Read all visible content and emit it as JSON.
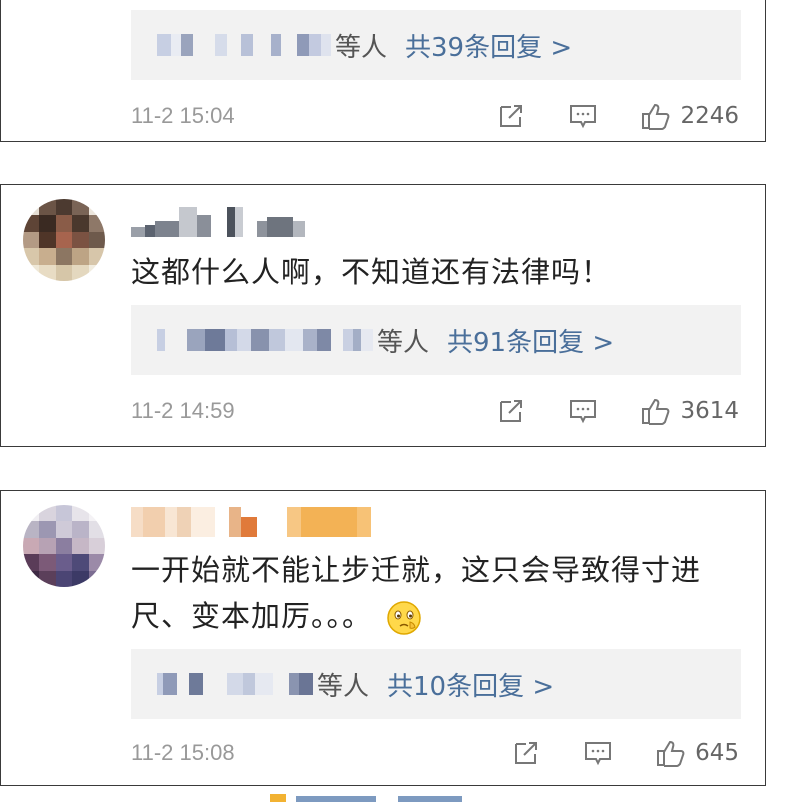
{
  "comments": [
    {
      "reply_suffix": "等人",
      "reply_link": "共39条回复 >",
      "time": "11-2 15:04",
      "likes": "2246"
    },
    {
      "text": "这都什么人啊，不知道还有法律吗！",
      "reply_suffix": "等人",
      "reply_link": "共91条回复 >",
      "time": "11-2 14:59",
      "likes": "3614"
    },
    {
      "text_line1": "一开始就不能让步迁就，这只会导致得寸进",
      "text_line2": "尺、变本加厉。。。",
      "emoji": "thinking-face-emoji",
      "reply_suffix": "等人",
      "reply_link": "共10条回复 >",
      "time": "11-2 15:08",
      "likes": "645"
    }
  ],
  "icons": {
    "share": "share-icon",
    "comment": "comment-icon",
    "like": "thumbs-up-icon"
  },
  "colors": {
    "link": "#4a6f9a",
    "reply_bg": "#f2f2f2",
    "time": "#999999",
    "card_border": "#3a3a3a"
  }
}
